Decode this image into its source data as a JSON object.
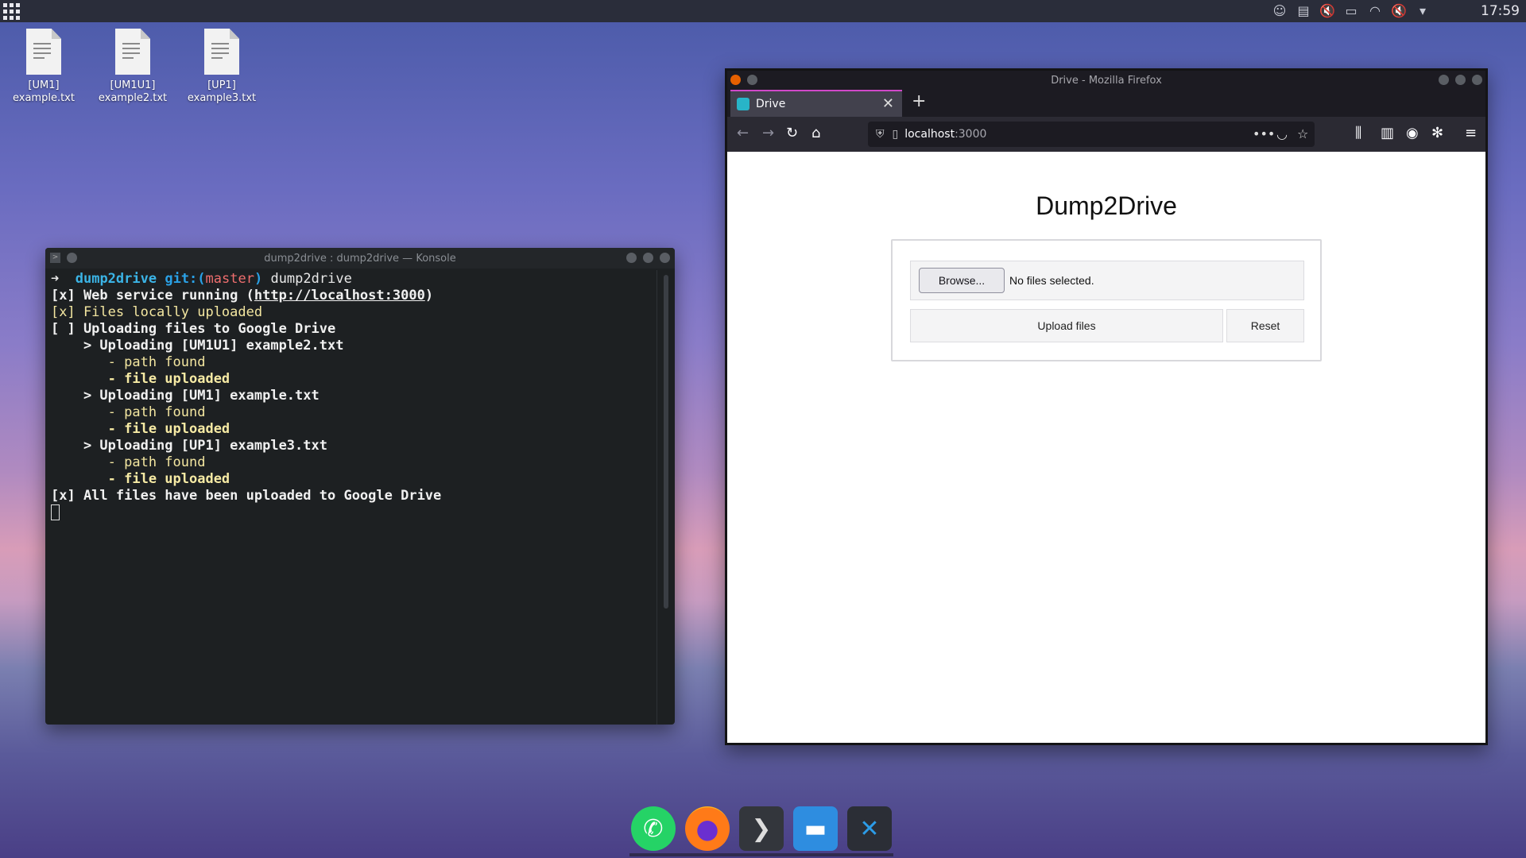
{
  "system": {
    "clock": "17:59"
  },
  "desktop_icons": [
    {
      "line1": "[UM1]",
      "line2": "example.txt"
    },
    {
      "line1": "[UM1U1]",
      "line2": "example2.txt"
    },
    {
      "line1": "[UP1]",
      "line2": "example3.txt"
    }
  ],
  "konsole": {
    "title": "dump2drive : dump2drive — Konsole",
    "prompt_arrow": "➜",
    "dir": "dump2drive",
    "git_label": "git:(",
    "branch": "master",
    "git_close": ")",
    "command": "dump2drive",
    "lines": {
      "l1_pre": "[x] Web service running (",
      "l1_url": "http://localhost:3000",
      "l1_post": ")",
      "l2": "[x] Files locally uploaded",
      "l3": "[ ] Uploading files to Google Drive",
      "up1": "    > Uploading [UM1U1] example2.txt",
      "pf1": "       - path found",
      "fu1": "       - file uploaded",
      "up2": "    > Uploading [UM1] example.txt",
      "pf2": "       - path found",
      "fu2": "       - file uploaded",
      "up3": "    > Uploading [UP1] example3.txt",
      "pf3": "       - path found",
      "fu3": "       - file uploaded",
      "done": "[x] All files have been uploaded to Google Drive"
    }
  },
  "firefox": {
    "window_title": "Drive - Mozilla Firefox",
    "tab_label": "Drive",
    "url_host": "localhost",
    "url_port": ":3000",
    "page": {
      "heading": "Dump2Drive",
      "browse_label": "Browse...",
      "no_files": "No files selected.",
      "upload_label": "Upload files",
      "reset_label": "Reset"
    }
  },
  "dock": {
    "items": [
      "whatsapp-icon",
      "firefox-icon",
      "terminal-icon",
      "files-icon",
      "vscode-icon"
    ]
  }
}
